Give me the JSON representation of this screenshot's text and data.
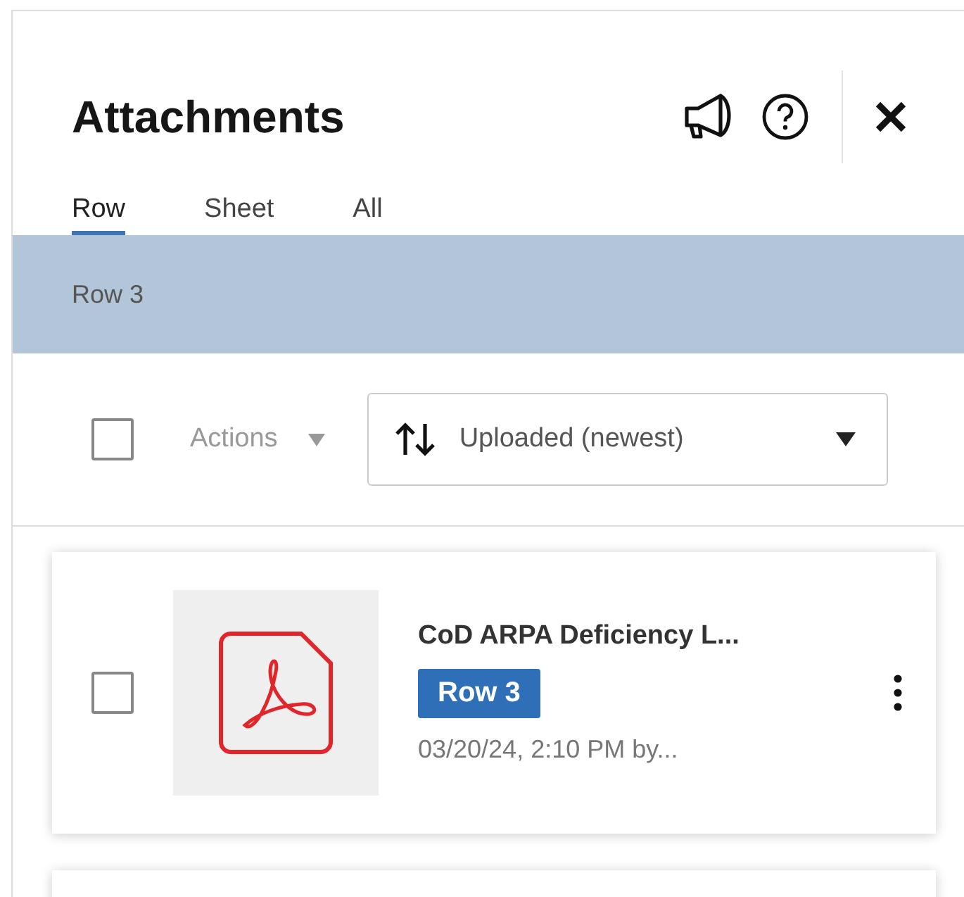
{
  "panel": {
    "title": "Attachments"
  },
  "tabs": [
    {
      "label": "Row",
      "selected": true
    },
    {
      "label": "Sheet",
      "selected": false
    },
    {
      "label": "All",
      "selected": false
    }
  ],
  "context_bar": {
    "label": "Row 3"
  },
  "toolbar": {
    "select_all": {
      "checked": false
    },
    "actions": {
      "label": "Actions",
      "disabled": true
    },
    "sort": {
      "value": "Uploaded (newest)"
    }
  },
  "attachments": [
    {
      "kind": "pdf",
      "name": "CoD ARPA Deficiency L...",
      "tag": "Row 3",
      "meta": "03/20/24, 2:10 PM by...",
      "checked": false
    }
  ]
}
